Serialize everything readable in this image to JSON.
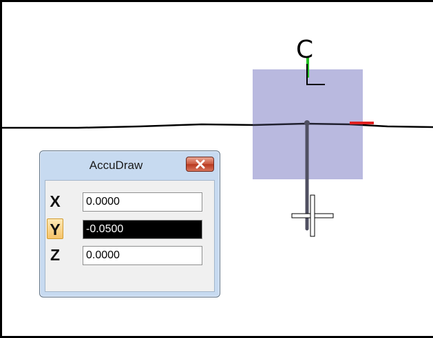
{
  "accudraw": {
    "title": "AccuDraw",
    "close_label": "Close",
    "x_label": "X",
    "x_value": "0.0000",
    "y_label": "Y",
    "y_value": "-0.0500",
    "z_label": "Z",
    "z_value": "0.0000",
    "active_axis": "Y"
  },
  "scene": {
    "compass_origin_glyph": "C",
    "compass_fill": "#b3b3dc",
    "x_axis_color": "#e02020",
    "y_axis_color": "#22c022",
    "element_color": "#000000"
  }
}
